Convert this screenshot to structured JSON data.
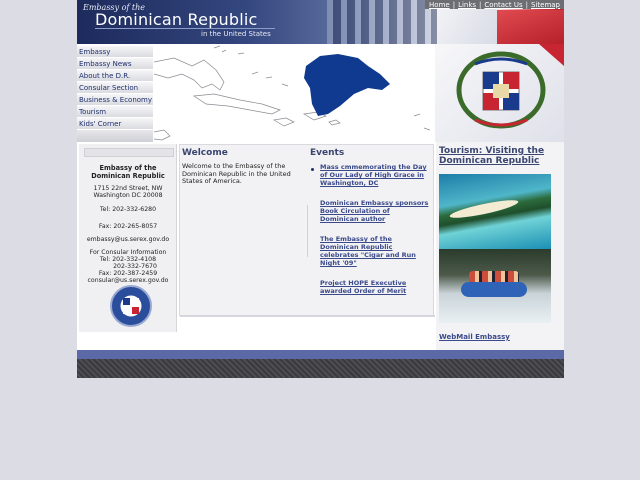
{
  "header": {
    "title_small": "Embassy of the",
    "title_big": "Dominican Republic",
    "title_sub": "in the United States"
  },
  "top_links": [
    "Home",
    "Links",
    "Contact Us",
    "Sitemap"
  ],
  "nav": [
    "Embassy",
    "Embassy News",
    "About the D.R.",
    "Consular Section",
    "Business & Economy",
    "Tourism",
    "Kids' Corner"
  ],
  "info": {
    "name": "Embassy of the Dominican Republic",
    "address1": "1715 22nd Street, NW",
    "address2": "Washington DC 20008",
    "tel": "Tel: 202-332-6280",
    "fax": "Fax: 202-265-8057",
    "email": "embassy@us.serex.gov.do",
    "consular_title": "For Consular Information",
    "consular_tel1": "Tel: 202-332-4108",
    "consular_tel2": "202-332-7670",
    "consular_fax": "Fax: 202-387-2459",
    "consular_email": "consular@us.serex.gov.do"
  },
  "welcome": {
    "heading": "Welcome",
    "text": "Welcome to the Embassy of the Dominican Republic in the United States of America."
  },
  "events": {
    "heading": "Events",
    "items": [
      "Mass cmmemorating the Day of Our Lady of High Grace in Washington, DC",
      "Dominican Embassy sponsors Book Circulation of Dominican author",
      "The Embassy of the Dominican Republic celebrates \"Cigar and Run Night '09\"",
      "Project HOPE Executive awarded Order of Merit"
    ]
  },
  "tourism": {
    "heading": "Tourism: Visiting the Dominican Republic"
  },
  "webmail": "WebMail Embassy",
  "colors": {
    "navy": "#1d2a5c",
    "link": "#3a4a8a",
    "footer_blue": "#5b6aa6",
    "map_fill": "#0f3a8f"
  }
}
